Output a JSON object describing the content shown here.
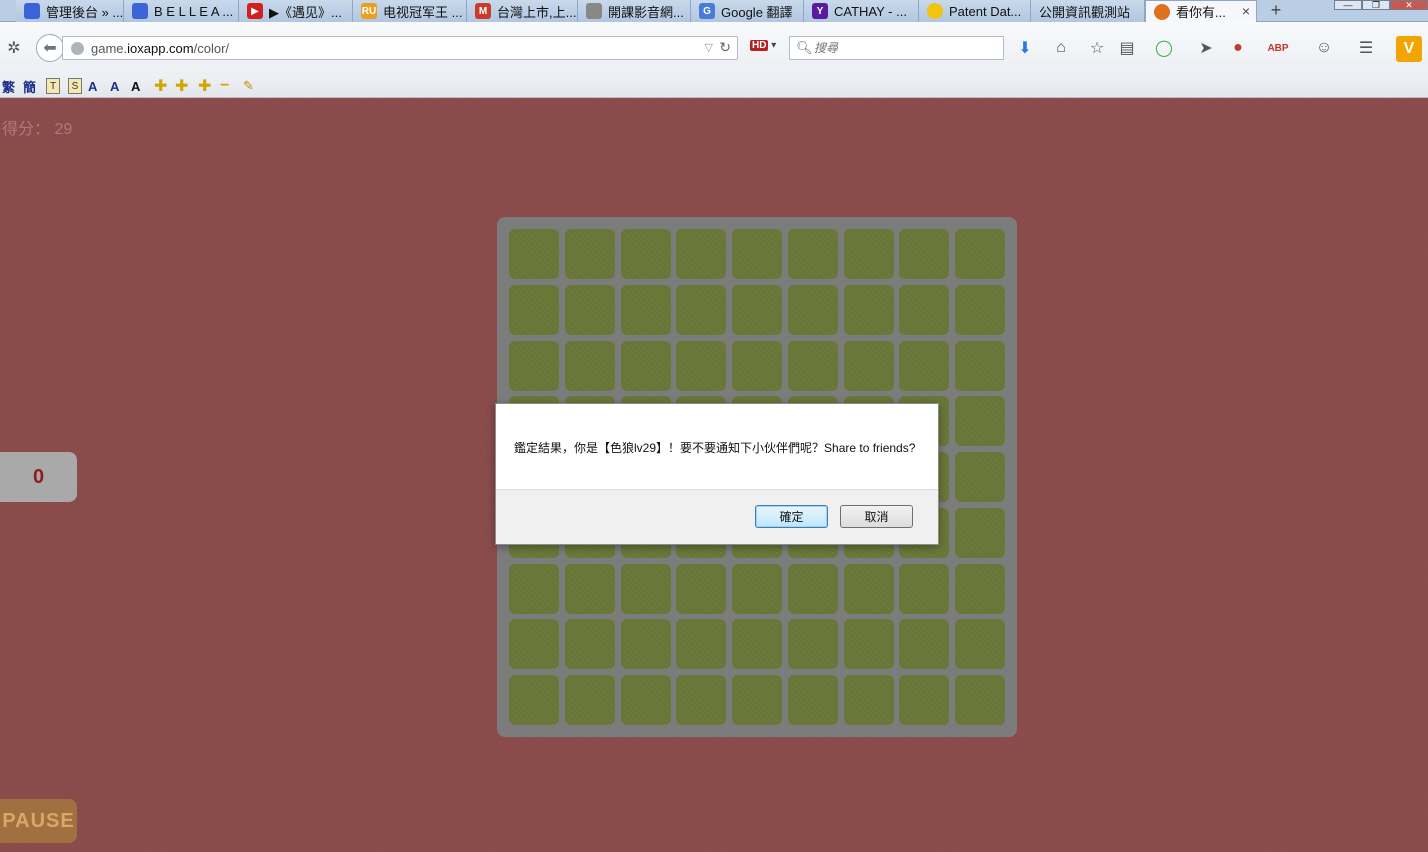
{
  "browser": {
    "tabs": [
      {
        "title": "管理後台 » ...",
        "icon_text": "",
        "icon_color": "#3a64d8"
      },
      {
        "title": "B E L L E A ...",
        "icon_text": "",
        "icon_color": "#3a64d8"
      },
      {
        "title": "▶《遇见》...",
        "icon_text": "▶",
        "icon_color": "#d22020"
      },
      {
        "title": "电视冠军王 ...",
        "icon_text": "RU",
        "icon_color": "#e8a020"
      },
      {
        "title": "台灣上市,上...",
        "icon_text": "M",
        "icon_color": "#c93b2b"
      },
      {
        "title": "開課影音網...",
        "icon_text": "",
        "icon_color": "#888888"
      },
      {
        "title": "Google 翻譯",
        "icon_text": "G",
        "icon_color": "#4a7bd6"
      },
      {
        "title": "CATHAY - ...",
        "icon_text": "Y",
        "icon_color": "#5b1b9e"
      },
      {
        "title": "Patent Dat...",
        "icon_text": "",
        "icon_color": "#f1c40f"
      },
      {
        "title": "公開資訊觀測站",
        "icon_text": "",
        "icon_color": "#b9cde5"
      },
      {
        "title": "看你有...",
        "icon_text": "",
        "icon_color": "#e07020"
      }
    ],
    "newtab": "+",
    "tab_close": "×",
    "url_host_prefix": "game.",
    "url_host": "ioxapp.com",
    "url_path": "/color/",
    "search_placeholder": "搜尋",
    "hd_label": "HD",
    "window_buttons": [
      "—",
      "❐",
      "✕"
    ]
  },
  "addons": {
    "trad": "繁",
    "simp": "簡",
    "t_box": "T",
    "s_box": "S",
    "font_a1": "A",
    "font_a2": "A",
    "font_a3": "A"
  },
  "game": {
    "score_label": "得分：",
    "score_value": "29",
    "timer": "0",
    "pause_label": "PAUSE",
    "grid_size": 9,
    "cell_color": "#6b7a3a",
    "page_color": "#8c4c4c"
  },
  "dialog": {
    "message": "鑑定結果，你是【色狼lv29】！要不要通知下小伙伴們呢？Share to friends?",
    "ok_label": "確定",
    "cancel_label": "取消"
  }
}
